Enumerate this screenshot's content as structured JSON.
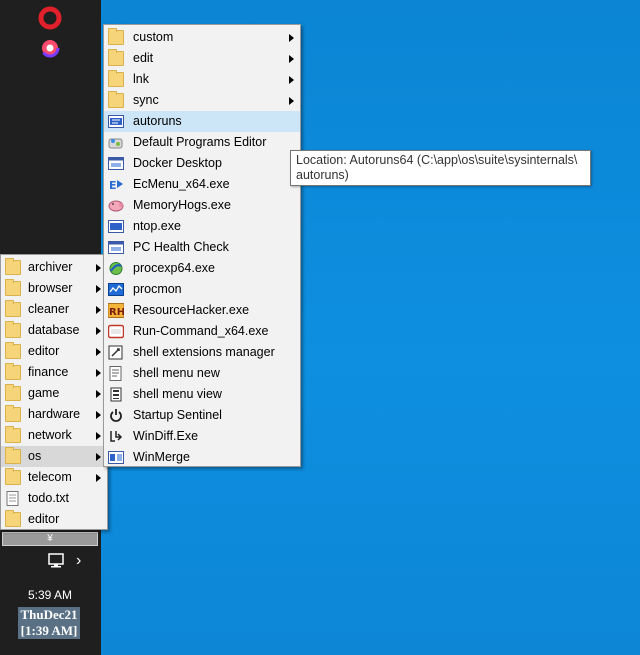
{
  "taskbar": {
    "apps": [
      "opera-icon",
      "opera-gx-icon"
    ],
    "tray_overflow_label": "¥",
    "clock_time": "5:39 AM",
    "clock_date_line1": "ThuDec21",
    "clock_date_line2": "[1:39 AM]"
  },
  "left_menu": {
    "items": [
      {
        "label": "archiver",
        "submenu": true
      },
      {
        "label": "browser",
        "submenu": true
      },
      {
        "label": "cleaner",
        "submenu": true
      },
      {
        "label": "database",
        "submenu": true
      },
      {
        "label": "editor",
        "submenu": true
      },
      {
        "label": "finance",
        "submenu": true
      },
      {
        "label": "game",
        "submenu": true
      },
      {
        "label": "hardware",
        "submenu": true
      },
      {
        "label": "network",
        "submenu": true
      },
      {
        "label": "os",
        "submenu": true
      },
      {
        "label": "telecom",
        "submenu": true
      },
      {
        "label": "todo.txt",
        "submenu": false
      },
      {
        "label": "editor",
        "submenu": false
      }
    ]
  },
  "right_menu": {
    "items": [
      {
        "label": "custom",
        "submenu": true
      },
      {
        "label": "edit",
        "submenu": true
      },
      {
        "label": "lnk",
        "submenu": true
      },
      {
        "label": "sync",
        "submenu": true
      },
      {
        "label": "autoruns",
        "submenu": false
      },
      {
        "label": "Default Programs Editor",
        "submenu": false
      },
      {
        "label": "Docker Desktop",
        "submenu": false
      },
      {
        "label": "EcMenu_x64.exe",
        "submenu": false
      },
      {
        "label": "MemoryHogs.exe",
        "submenu": false
      },
      {
        "label": "ntop.exe",
        "submenu": false
      },
      {
        "label": "PC Health Check",
        "submenu": false
      },
      {
        "label": "procexp64.exe",
        "submenu": false
      },
      {
        "label": "procmon",
        "submenu": false
      },
      {
        "label": "ResourceHacker.exe",
        "submenu": false
      },
      {
        "label": "Run-Command_x64.exe",
        "submenu": false
      },
      {
        "label": "shell extensions manager",
        "submenu": false
      },
      {
        "label": "shell menu new",
        "submenu": false
      },
      {
        "label": "shell menu view",
        "submenu": false
      },
      {
        "label": "Startup Sentinel",
        "submenu": false
      },
      {
        "label": "WinDiff.Exe",
        "submenu": false
      },
      {
        "label": "WinMerge",
        "submenu": false
      }
    ]
  },
  "tooltip": {
    "line1": "Location: Autoruns64 (C:\\app\\os\\suite\\sysinternals\\",
    "line2": "autoruns)"
  },
  "colors": {
    "desktop": "#0f86d6",
    "taskbar": "#1f1f1f",
    "highlight": "#cde6f7",
    "folder": "#f6d57a"
  }
}
